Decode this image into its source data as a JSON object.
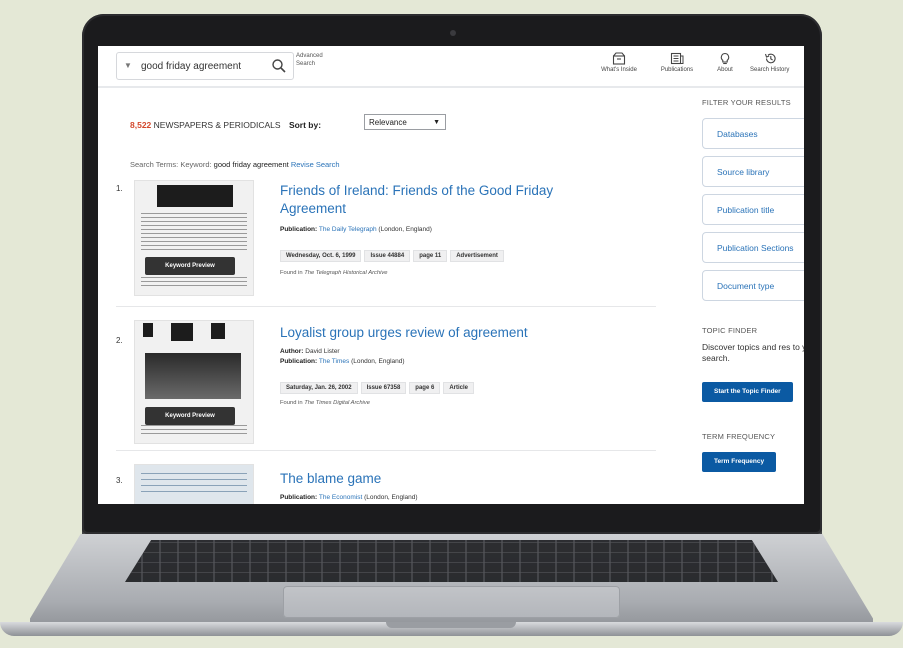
{
  "search": {
    "value": "good friday agreement",
    "advanced_label_1": "Advanced",
    "advanced_label_2": "Search"
  },
  "nav": [
    {
      "label": "What's Inside",
      "icon": "box-icon"
    },
    {
      "label": "Publications",
      "icon": "newspaper-icon"
    },
    {
      "label": "About",
      "icon": "lightbulb-icon"
    },
    {
      "label": "Search History",
      "icon": "history-icon"
    }
  ],
  "results_header": {
    "count": "8,522",
    "label": "NEWSPAPERS & PERIODICALS",
    "sort_label": "Sort by:",
    "sort_value": "Relevance"
  },
  "search_terms": {
    "label": "Search Terms:",
    "keyword_label": "Keyword:",
    "keyword": "good friday agreement",
    "revise": "Revise Search"
  },
  "results": [
    {
      "num": "1.",
      "title": "Friends of Ireland: Friends of the Good Friday Agreement",
      "author_label": "",
      "author": "",
      "publication_label": "Publication:",
      "publication": "The Daily Telegraph",
      "place": "(London, England)",
      "tags": [
        "Wednesday, Oct. 6, 1999",
        "Issue 44884",
        "page 11",
        "Advertisement"
      ],
      "found_prefix": "Found in",
      "found_archive": "The Telegraph Historical Archive",
      "preview": "Keyword Preview"
    },
    {
      "num": "2.",
      "title": "Loyalist group urges review of agreement",
      "author_label": "Author:",
      "author": "David Lister",
      "publication_label": "Publication:",
      "publication": "The Times",
      "place": "(London, England)",
      "tags": [
        "Saturday, Jan. 26, 2002",
        "Issue 67358",
        "page 6",
        "Article"
      ],
      "found_prefix": "Found in",
      "found_archive": "The Times Digital Archive",
      "preview": "Keyword Preview"
    },
    {
      "num": "3.",
      "title": "The blame game",
      "publication_label": "Publication:",
      "publication": "The Economist",
      "place": "(London, England)"
    }
  ],
  "filter": {
    "heading": "FILTER YOUR RESULTS",
    "items": [
      "Databases",
      "Source library",
      "Publication title",
      "Publication Sections",
      "Document type"
    ],
    "topic_heading": "TOPIC FINDER",
    "topic_desc": "Discover topics and res to your search.",
    "topic_button": "Start the Topic Finder",
    "term_heading": "TERM FREQUENCY",
    "term_button": "Term Frequency"
  },
  "colors": {
    "link": "#2a73b8",
    "count": "#d3482c",
    "button": "#0b5aa3",
    "background": "#e4e8d6"
  }
}
